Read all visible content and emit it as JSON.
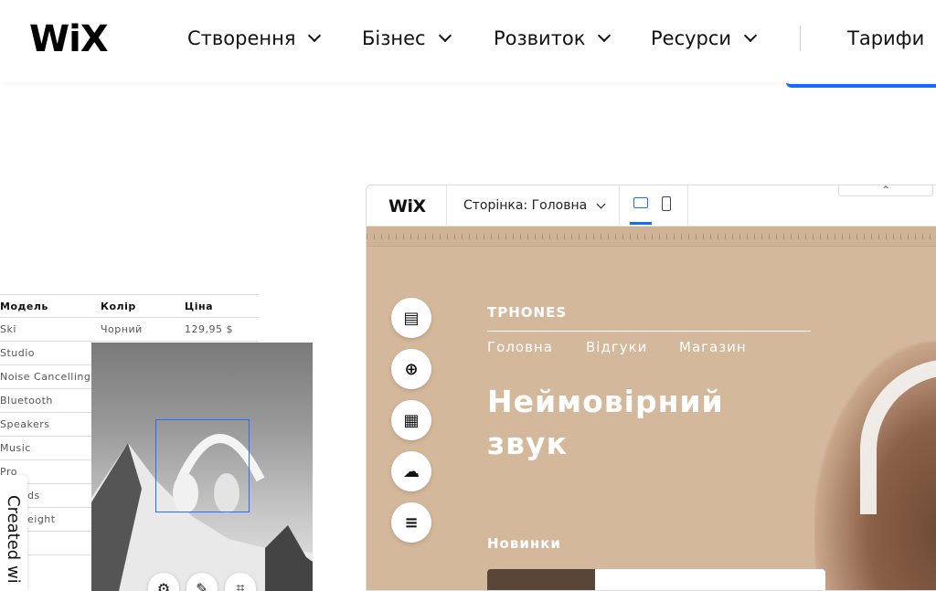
{
  "nav": {
    "logo": "WiX",
    "items": [
      {
        "label": "Створення"
      },
      {
        "label": "Бізнес"
      },
      {
        "label": "Розвиток"
      },
      {
        "label": "Ресурси"
      }
    ],
    "pricing": "Тарифи"
  },
  "table": {
    "headers": [
      "Модель",
      "Колір",
      "Ціна"
    ],
    "first_row": {
      "color": "Чорний",
      "price": "129,95 $"
    },
    "models": [
      "Ski",
      "Studio",
      "Noise Cancelling",
      "Bluetooth",
      "Speakers",
      "Music",
      "Pro",
      "ds",
      "eight"
    ]
  },
  "created_with": "Created wi",
  "editor": {
    "logo": "WiX",
    "page_label": "Сторінка: Головна",
    "collapse_icon": "^",
    "side_icons": [
      "pages-icon",
      "add-icon",
      "apps-icon",
      "upload-icon",
      "database-icon"
    ]
  },
  "site": {
    "brand": "TPHONES",
    "nav": [
      "Головна",
      "Відгуки",
      "Магазин"
    ],
    "headline_line1": "Неймовірний",
    "headline_line2": "звук",
    "news": "Новинки"
  },
  "colors": {
    "accent": "#116dff",
    "editor_bg": "#d4b89c"
  }
}
